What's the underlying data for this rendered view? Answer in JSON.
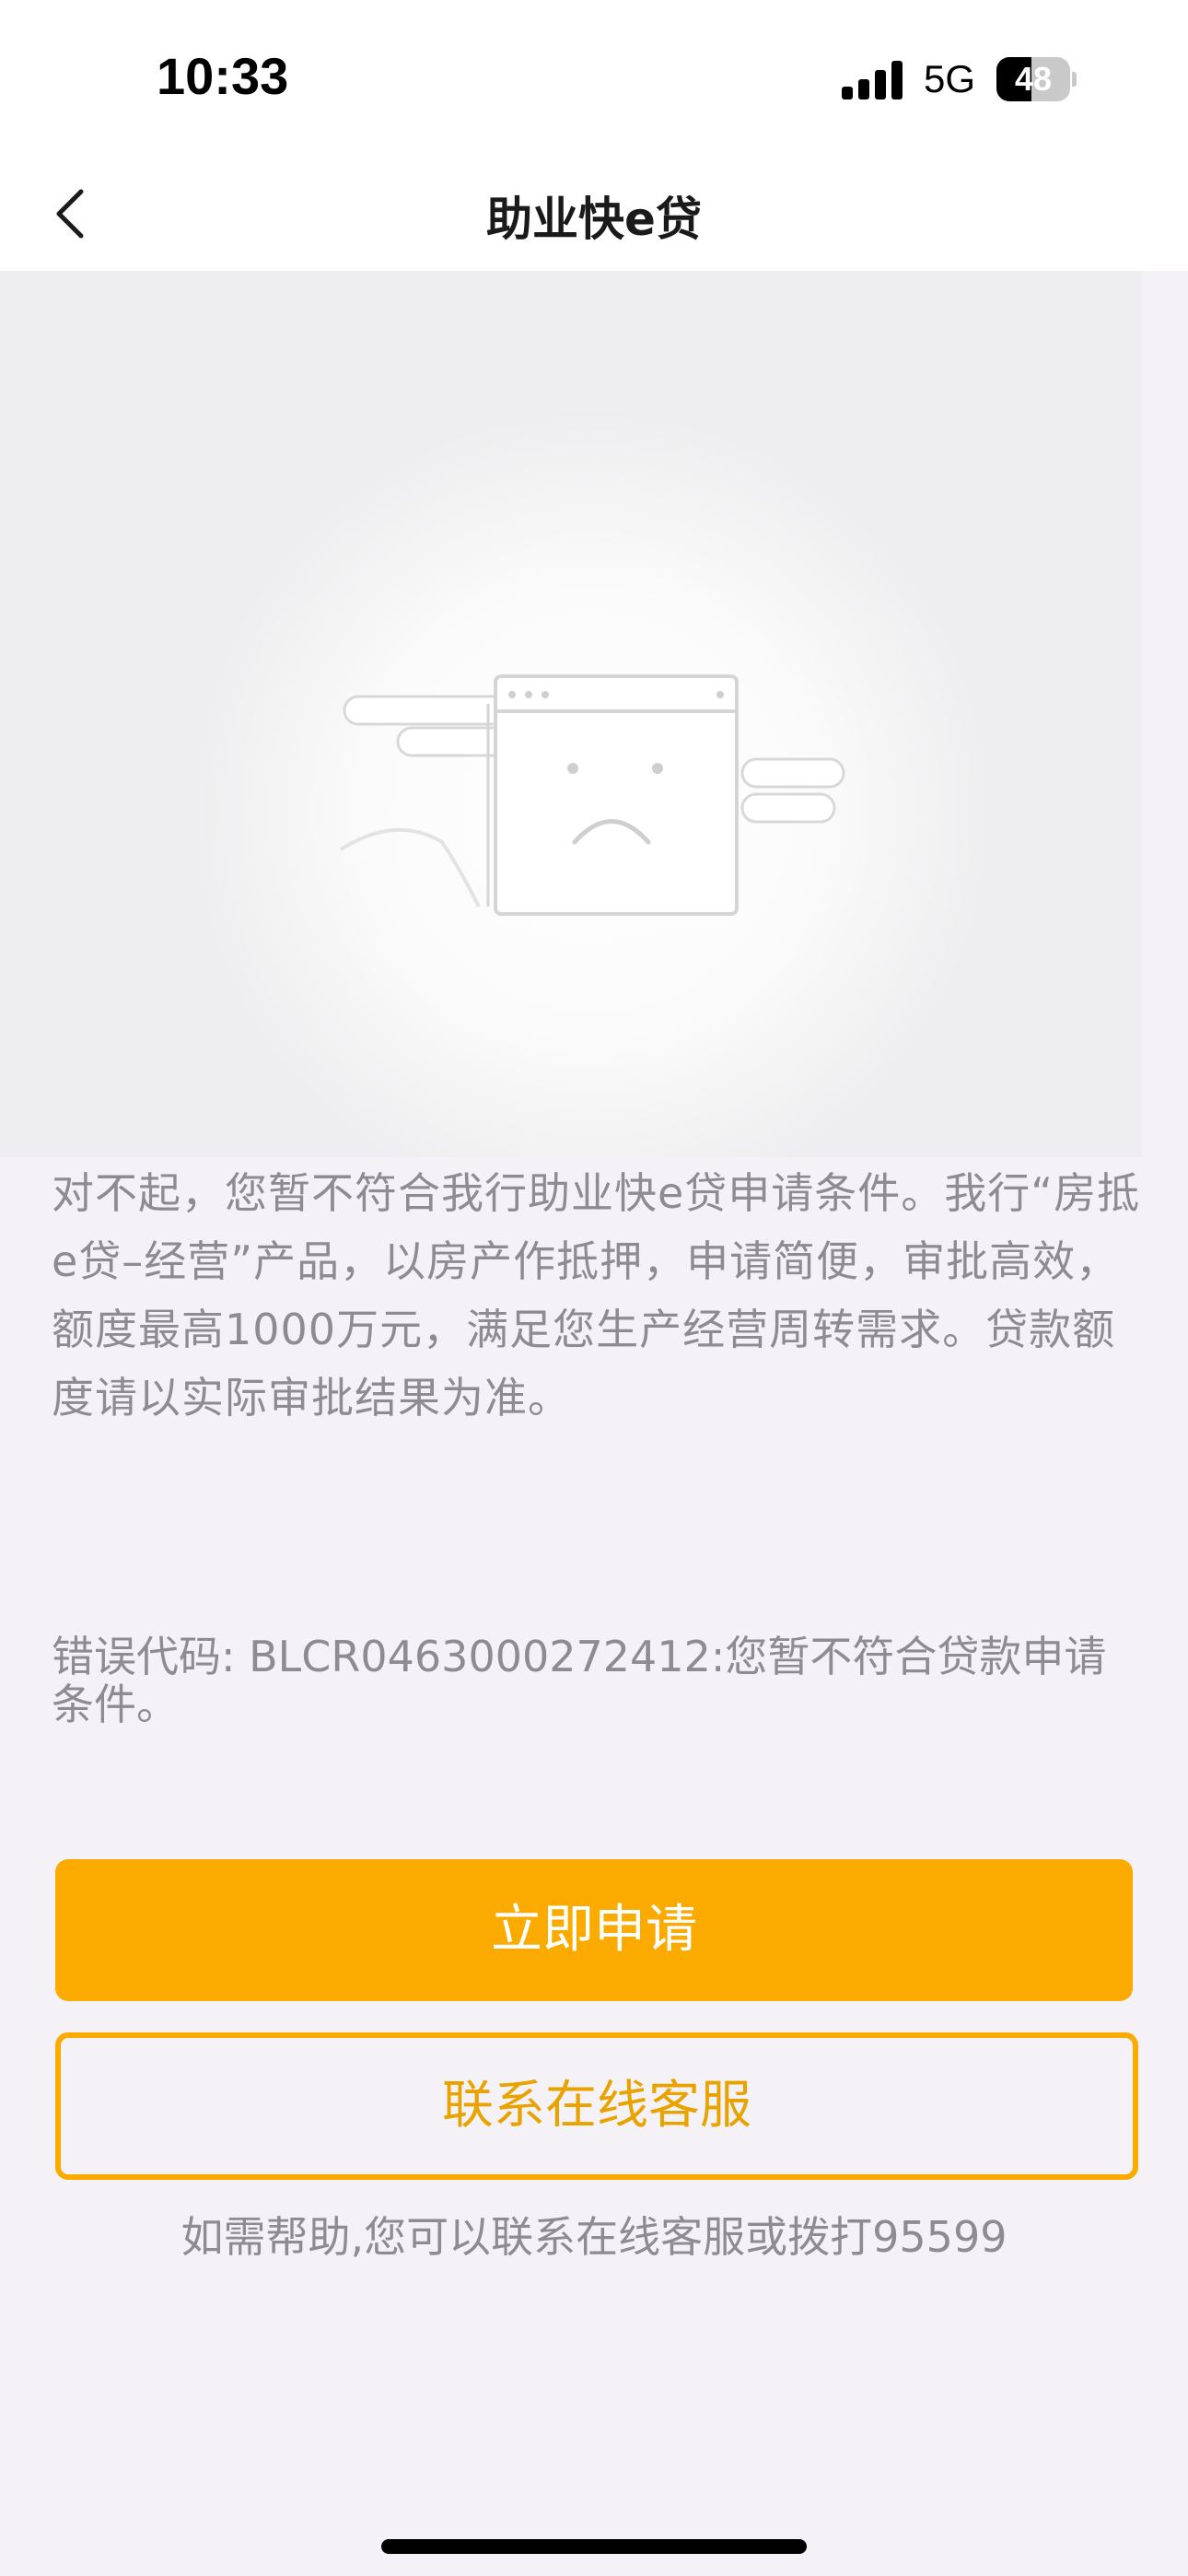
{
  "status_bar": {
    "time": "10:33",
    "network": "5G",
    "battery": "48",
    "battery_level": 0.48
  },
  "nav": {
    "title": "助业快e贷",
    "back_icon": "chevron-left-icon"
  },
  "illustration": {
    "icon": "sad-browser-window-icon"
  },
  "message": {
    "text": "对不起，您暂不符合我行助业快e贷申请条件。我行“房抵e贷–经营”产品，以房产作抵押，申请简便，审批高效，额度最高1000万元，满足您生产经营周转需求。贷款额度请以实际审批结果为准。",
    "error_code": "错误代码: BLCR0463000272412:您暂不符合贷款申请条件。"
  },
  "actions": {
    "apply_label": "立即申请",
    "contact_label": "联系在线客服"
  },
  "help": {
    "text": "如需帮助,您可以联系在线客服或拨打95599"
  },
  "colors": {
    "accent": "#fbab00",
    "accent_text": "#e9a300",
    "muted_text": "#8e8c90",
    "background": "#f5f2f7"
  }
}
